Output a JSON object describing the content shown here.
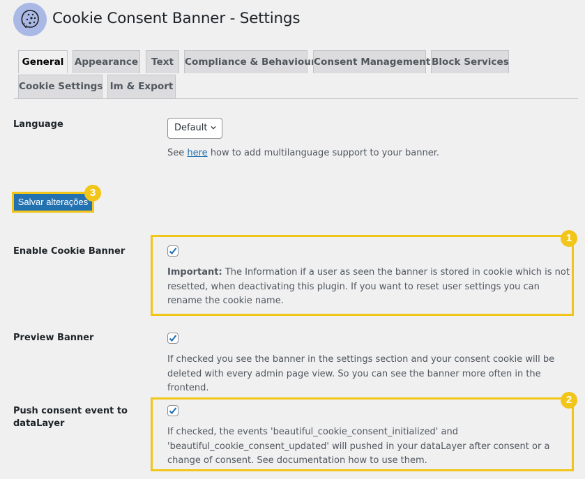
{
  "header": {
    "logo_icon": "cookie-icon",
    "title": "Cookie Consent Banner - Settings"
  },
  "tabs": [
    {
      "label": "General",
      "active": true
    },
    {
      "label": "Appearance",
      "active": false
    },
    {
      "label": "Text",
      "active": false
    },
    {
      "label": "Compliance & Behaviour",
      "active": false
    },
    {
      "label": "Consent Management",
      "active": false
    },
    {
      "label": "Block Services",
      "active": false
    },
    {
      "label": "Cookie Settings",
      "active": false
    },
    {
      "label": "Im & Export",
      "active": false
    }
  ],
  "language": {
    "label": "Language",
    "select_value": "Default",
    "help_prefix": "See ",
    "help_link": "here",
    "help_suffix": " how to add multilanguage support to your banner."
  },
  "save_button": {
    "label": "Salvar alterações",
    "badge": "3"
  },
  "settings": [
    {
      "label": "Enable Cookie Banner",
      "checked": true,
      "desc_strong": "Important:",
      "description": " The Information if a user as seen the banner is stored in cookie which is not resetted, when deactivating this plugin. If you want to reset user settings you can rename the cookie name.",
      "badge": "1"
    },
    {
      "label": "Preview Banner",
      "checked": true,
      "description": "If checked you see the banner in the settings section and your consent cookie will be deleted with every admin page view. So you can see the banner more often in the frontend."
    },
    {
      "label": "Push consent event to dataLayer",
      "checked": true,
      "description": "If checked, the events 'beautiful_cookie_consent_initialized' and 'beautiful_cookie_consent_updated' will pushed in your dataLayer after consent or a change of consent. See documentation how to use them.",
      "badge": "2"
    }
  ],
  "colors": {
    "accent": "#2271b1",
    "highlight": "#f2c519",
    "background": "#f0f0f1"
  }
}
